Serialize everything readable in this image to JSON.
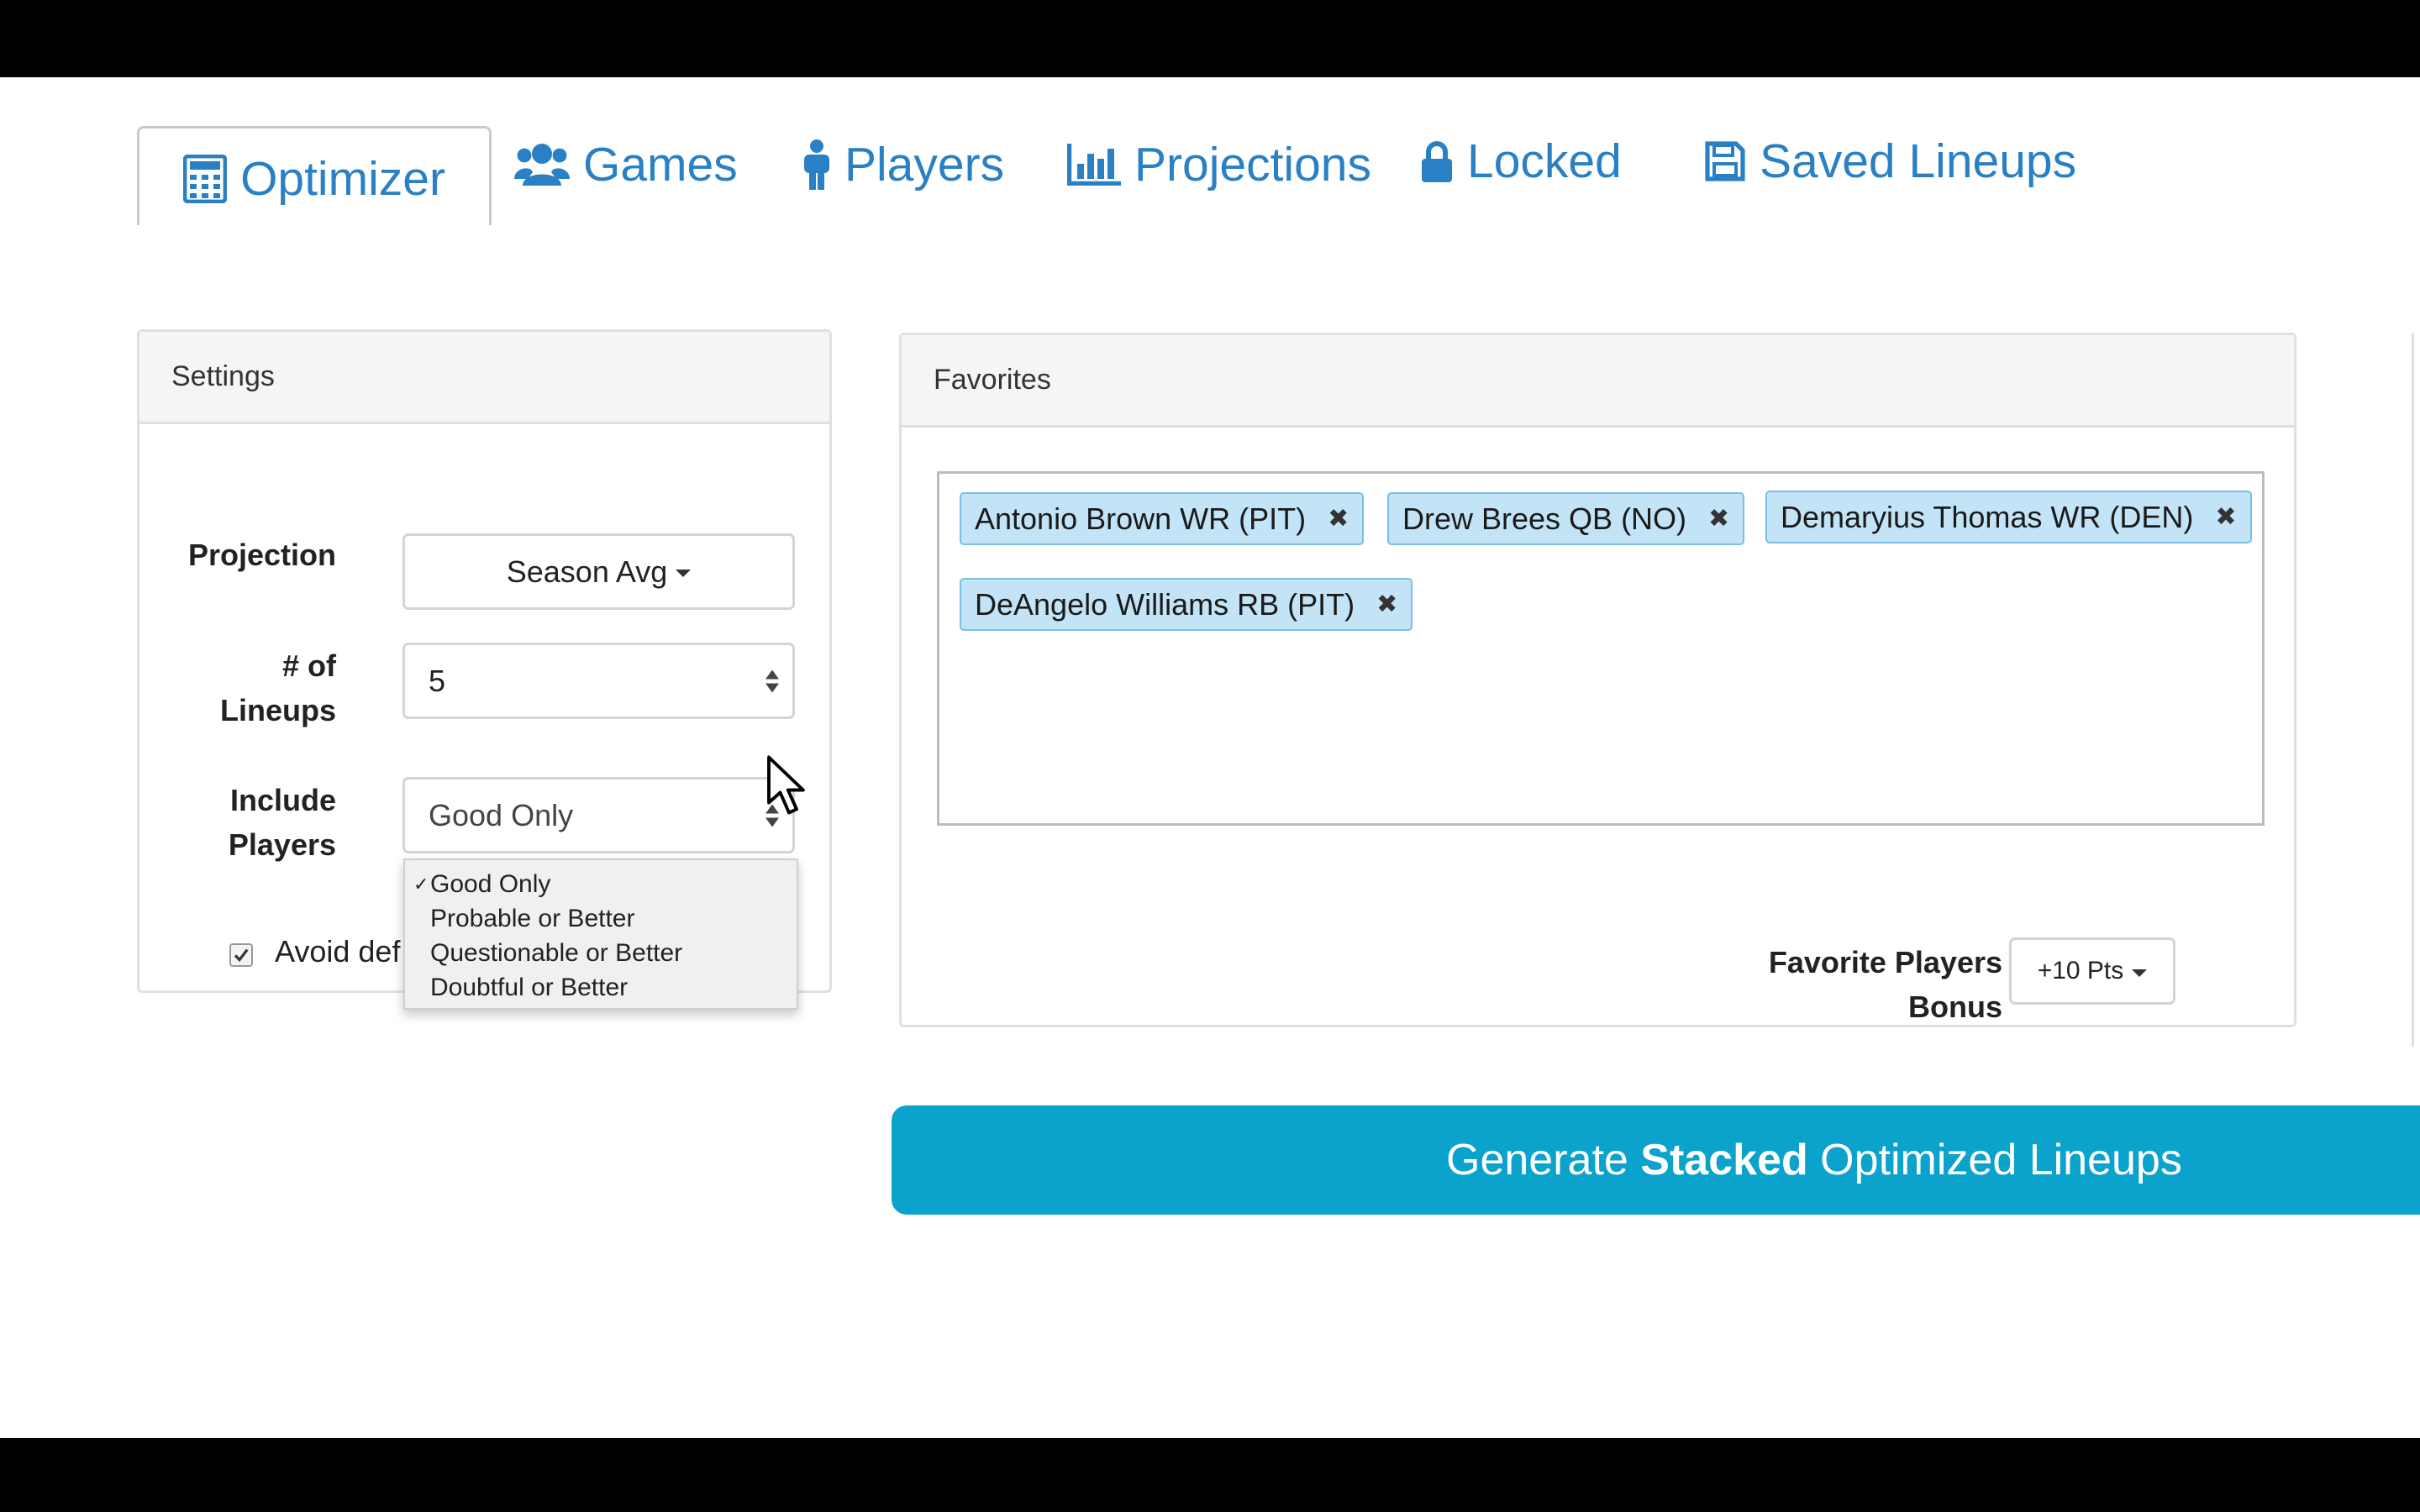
{
  "tabs": [
    {
      "label": "Optimizer",
      "icon": "calculator-icon",
      "active": true
    },
    {
      "label": "Games",
      "icon": "users-icon",
      "active": false
    },
    {
      "label": "Players",
      "icon": "male-icon",
      "active": false
    },
    {
      "label": "Projections",
      "icon": "bar-chart-icon",
      "active": false
    },
    {
      "label": "Locked",
      "icon": "lock-icon",
      "active": false
    },
    {
      "label": "Saved Lineups",
      "icon": "floppy-disk-icon",
      "active": false
    }
  ],
  "settings": {
    "title": "Settings",
    "projection_label": "Projection",
    "projection_value": "Season Avg",
    "lineups_label_1": "# of",
    "lineups_label_2": "Lineups",
    "lineups_value": "5",
    "include_label_1": "Include",
    "include_label_2": "Players",
    "include_value": "Good Only",
    "include_options": [
      "Good Only",
      "Probable or Better",
      "Questionable or Better",
      "Doubtful or Better"
    ],
    "selected_check": "✓",
    "avoid_label": "Avoid def",
    "avoid_checked": true
  },
  "favorites": {
    "title": "Favorites",
    "tags": [
      "Antonio Brown WR (PIT)",
      "Drew Brees QB (NO)",
      "Demaryius Thomas WR (DEN)",
      "DeAngelo Williams RB (PIT)"
    ],
    "remove_glyph": "✖",
    "bonus_label_1": "Favorite Players",
    "bonus_label_2": "Bonus",
    "bonus_value": "+10 Pts"
  },
  "generate": {
    "pre": "Generate",
    "strong": "Stacked",
    "post": "Optimized Lineups"
  },
  "colors": {
    "tab_blue": "#2a80c4",
    "tag_fill": "#c3e3f7",
    "generate_bg": "#0ba2cc"
  }
}
